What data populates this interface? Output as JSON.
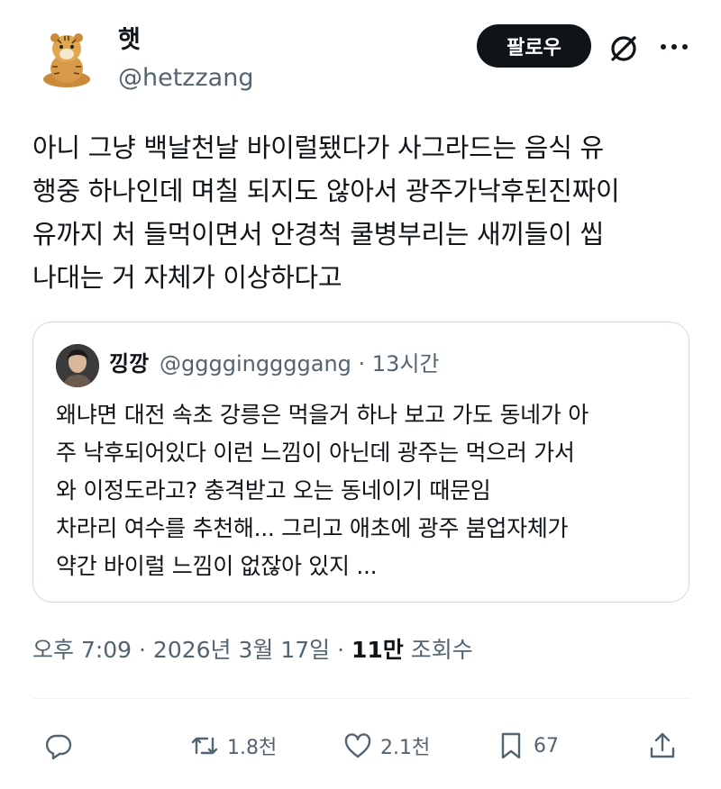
{
  "author": {
    "name": "햇",
    "handle": "@hetzzang",
    "avatar_icon": "tiger-plush-avatar"
  },
  "header": {
    "follow_label": "팔로우",
    "grok_icon": "grok-slash-icon",
    "more_icon": "more-dots-icon"
  },
  "tweet": {
    "lines": [
      "아니 그냥 백날천날 바이럴됐다가 사그라드는 음식 유",
      "행중 하나인데 며칠 되지도 않아서 광주가낙후된진짜이",
      "유까지 처 들먹이면서 안경척 쿨병부리는 새끼들이 씹",
      "나대는 거 자체가 이상하다고"
    ]
  },
  "quote": {
    "name": "낑깡",
    "handle": "@gggginggggang · 13시간",
    "lines": [
      "왜냐면 대전 속초 강릉은 먹을거 하나 보고 가도 동네가 아",
      "주 낙후되어있다 이런 느낌이 아닌데 광주는 먹으러 가서",
      "와 이정도라고? 충격받고 오는 동네이기 때문임",
      "차라리 여수를 추천해... 그리고 애초에 광주 붐업자체가",
      "약간 바이럴 느낌이 없잖아 있지 ..."
    ]
  },
  "meta": {
    "time_date": "오후 7:09 · 2026년 3월 17일 · ",
    "views_count": "11만",
    "views_label": " 조회수"
  },
  "actions": {
    "reply_icon": "reply-icon",
    "retweet_count": "1.8천",
    "like_count": "2.1천",
    "bookmark_count": "67",
    "share_icon": "share-icon"
  },
  "colors": {
    "text": "#0f1419",
    "secondary": "#536471",
    "border": "#cfd9de",
    "follow_bg": "#0f1419"
  }
}
